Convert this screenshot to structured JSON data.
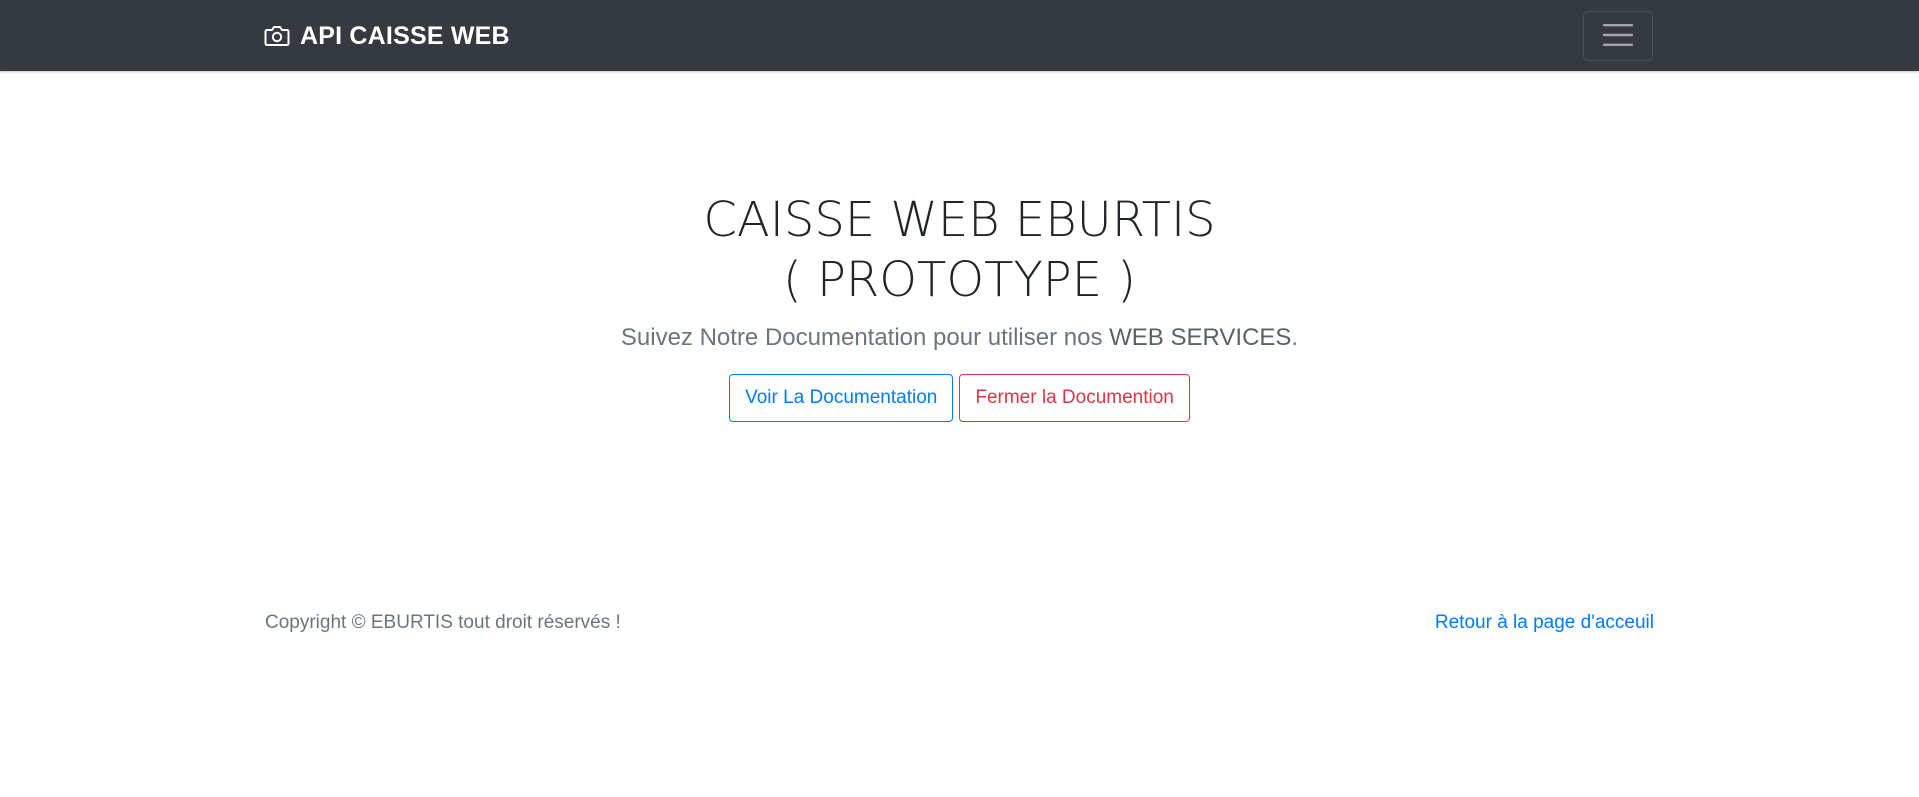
{
  "navbar": {
    "brand_label": "API CAISSE WEB",
    "brand_icon": "camera-icon",
    "toggler_icon": "hamburger-menu-icon",
    "background_color": "#343a40"
  },
  "hero": {
    "title_line1": "CAISSE WEB EBURTIS",
    "title_line2": "( PROTOTYPE )",
    "lead_prefix": "Suivez Notre Documentation pour utiliser nos ",
    "lead_strong": "WEB SERVICES",
    "lead_suffix": ".",
    "view_button_label": "Voir La Documentation",
    "close_button_label": "Fermer la Documention"
  },
  "footer": {
    "copyright": "Copyright © EBURTIS tout droit réservés !",
    "back_link_label": "Retour à la page d'acceuil"
  },
  "colors": {
    "primary": "#007bff",
    "danger": "#dc3545",
    "muted": "#6c757d"
  }
}
